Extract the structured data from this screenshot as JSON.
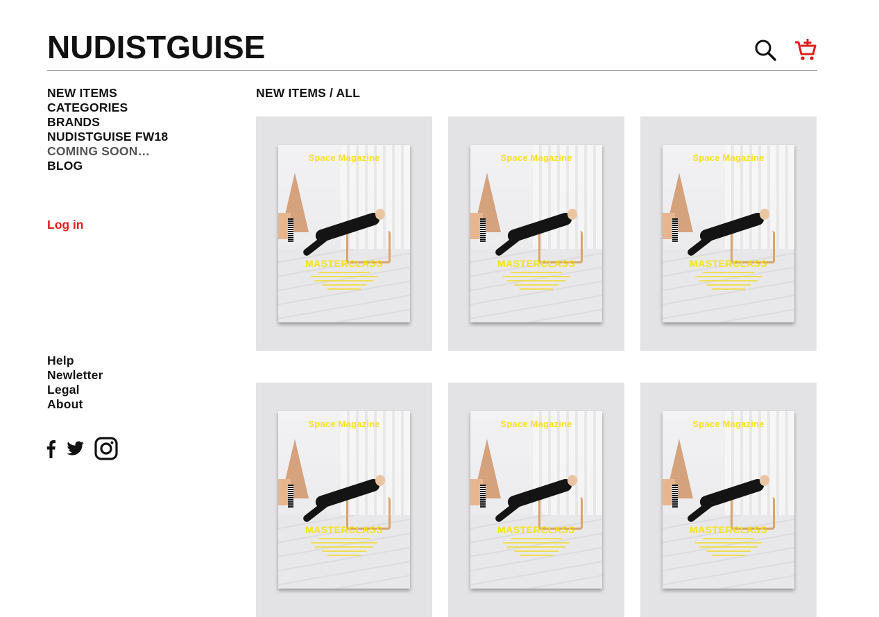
{
  "brand": {
    "logo": "NUDISTGUISE"
  },
  "header": {
    "icons": [
      "search-icon",
      "add-to-cart-icon"
    ],
    "cart_color": "#e11d1d"
  },
  "nav": {
    "items": [
      "NEW ITEMS",
      "CATEGORIES",
      "BRANDS",
      "NUDISTGUISE FW18",
      "COMING SOON…",
      "BLOG"
    ]
  },
  "auth": {
    "login_label": "Log in",
    "login_color": "#e11d1d"
  },
  "footer_nav": {
    "items": [
      "Help",
      "Newletter",
      "Legal",
      "About"
    ]
  },
  "social": {
    "icons": [
      "facebook-icon",
      "twitter-icon",
      "instagram-icon"
    ]
  },
  "breadcrumb": "NEW ITEMS / ALL",
  "products": [
    {
      "cover_title": "Space Magazine",
      "cover_headline": "MASTERCLASS"
    },
    {
      "cover_title": "Space Magazine",
      "cover_headline": "MASTERCLASS"
    },
    {
      "cover_title": "Space Magazine",
      "cover_headline": "MASTERCLASS"
    },
    {
      "cover_title": "Space Magazine",
      "cover_headline": "MASTERCLASS"
    },
    {
      "cover_title": "Space Magazine",
      "cover_headline": "MASTERCLASS"
    },
    {
      "cover_title": "Space Magazine",
      "cover_headline": "MASTERCLASS"
    }
  ]
}
